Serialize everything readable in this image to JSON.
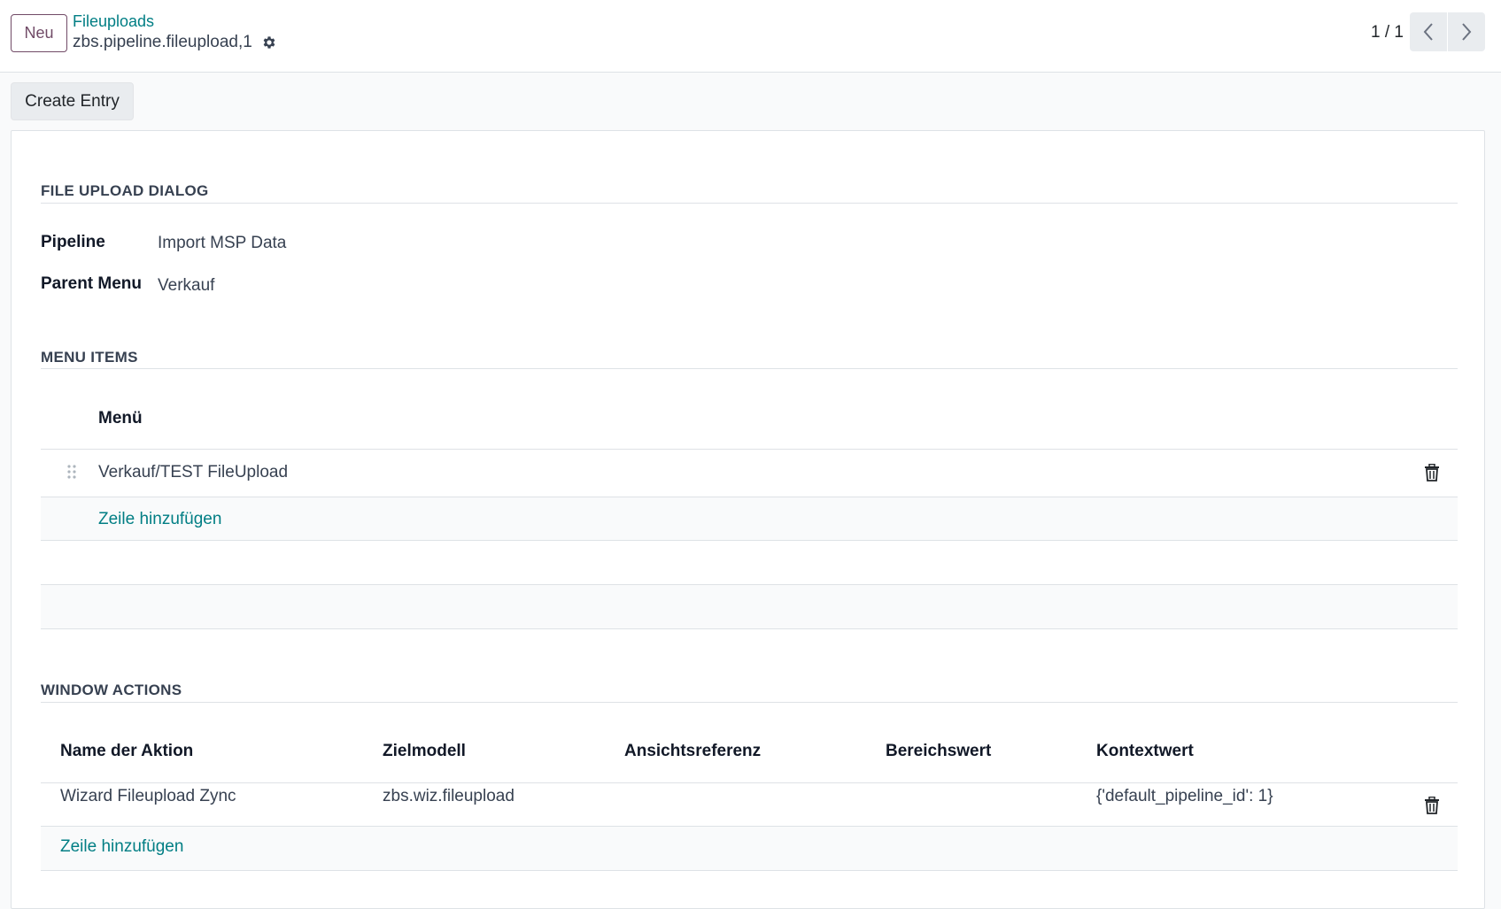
{
  "control_panel": {
    "new_button": "Neu",
    "breadcrumb": "Fileuploads",
    "record_name": "zbs.pipeline.fileupload,1",
    "pager": "1 / 1"
  },
  "status_bar": {
    "create_entry_button": "Create Entry"
  },
  "form": {
    "section_file_upload": "FILE UPLOAD DIALOG",
    "fields": [
      {
        "label": "Pipeline",
        "value": "Import MSP Data"
      },
      {
        "label": "Parent Menu",
        "value": "Verkauf"
      }
    ],
    "section_menu_items": "MENU ITEMS",
    "menu_items": {
      "columns": [
        "Menü"
      ],
      "rows": [
        {
          "menu": "Verkauf/TEST FileUpload"
        }
      ],
      "add_line": "Zeile hinzufügen"
    },
    "section_window_actions": "WINDOW ACTIONS",
    "window_actions": {
      "columns": [
        "Name der Aktion",
        "Zielmodell",
        "Ansichtsreferenz",
        "Bereichswert",
        "Kontextwert"
      ],
      "rows": [
        {
          "name": "Wizard Fileupload Zync",
          "model": "zbs.wiz.fileupload",
          "view_ref": "",
          "domain": "",
          "context": "{'default_pipeline_id': 1}"
        }
      ],
      "add_line": "Zeile hinzufügen"
    }
  },
  "colors": {
    "primary": "#714b67",
    "link": "#017e84"
  },
  "icons": {
    "settings": "gear-icon",
    "prev": "chevron-left-icon",
    "next": "chevron-right-icon",
    "delete": "trash-icon",
    "handle": "drag-handle-icon"
  }
}
